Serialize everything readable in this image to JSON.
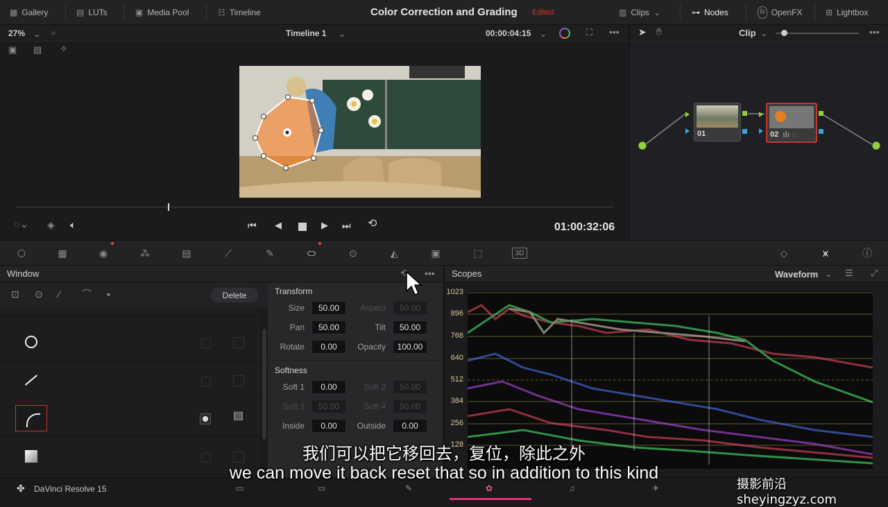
{
  "topbar": {
    "gallery": "Gallery",
    "luts": "LUTs",
    "media_pool": "Media Pool",
    "timeline": "Timeline",
    "page_title": "Color Correction and Grading",
    "edited": "Edited",
    "clips": "Clips",
    "nodes": "Nodes",
    "openfx": "OpenFX",
    "lightbox": "Lightbox"
  },
  "viewer": {
    "zoom": "27%",
    "timeline_name": "Timeline 1",
    "clip_timecode": "00:00:04:15",
    "timecode": "01:00:32:06"
  },
  "node_panel": {
    "mode": "Clip",
    "node1_label": "01",
    "node2_label": "02"
  },
  "window_panel": {
    "title": "Window",
    "delete_label": "Delete",
    "transform_title": "Transform",
    "softness_title": "Softness",
    "size_label": "Size",
    "size_value": "50.00",
    "aspect_label": "Aspect",
    "aspect_value": "50.00",
    "pan_label": "Pan",
    "pan_value": "50.00",
    "tilt_label": "Tilt",
    "tilt_value": "50.00",
    "rotate_label": "Rotate",
    "rotate_value": "0.00",
    "opacity_label": "Opacity",
    "opacity_value": "100.00",
    "soft1_label": "Soft 1",
    "soft1_value": "0.00",
    "soft2_label": "Soft 2",
    "soft2_value": "50.00",
    "soft3_label": "Soft 3",
    "soft3_value": "50.00",
    "soft4_label": "Soft 4",
    "soft4_value": "50.00",
    "inside_label": "Inside",
    "inside_value": "0.00",
    "outside_label": "Outside",
    "outside_value": "0.00"
  },
  "scopes": {
    "title": "Scopes",
    "type": "Waveform",
    "ticks": [
      "1023",
      "896",
      "768",
      "640",
      "512",
      "384",
      "256",
      "128"
    ]
  },
  "app": {
    "name": "DaVinci Resolve 15"
  },
  "subtitles": {
    "zh": "我们可以把它移回去，复位，除此之外",
    "en": "we can move it back reset that so in addition to this kind"
  },
  "watermark": "摄影前沿 sheyingzyz.com",
  "colors": {
    "accent_red": "#c0392b",
    "node_green": "#8fd13b",
    "node_blue": "#3ba3d6",
    "tick_yellow": "#d8c79a"
  }
}
